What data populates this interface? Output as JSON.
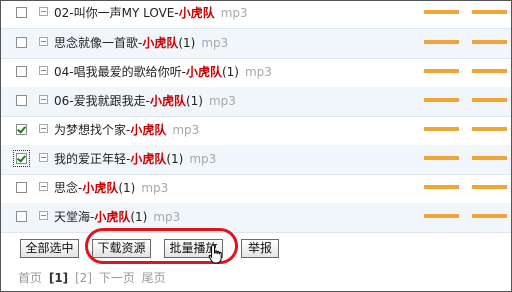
{
  "songs": [
    {
      "checked": false,
      "prefix": "02-叫你一声MY LOVE-",
      "artist": "小虎队",
      "count": "",
      "ext": "mp3"
    },
    {
      "checked": false,
      "prefix": "思念就像一首歌-",
      "artist": "小虎队",
      "count": "(1)",
      "ext": "mp3"
    },
    {
      "checked": false,
      "prefix": "04-唱我最爱的歌给你听-",
      "artist": "小虎队",
      "count": "(1)",
      "ext": "mp3"
    },
    {
      "checked": false,
      "prefix": "06-爱我就跟我走-",
      "artist": "小虎队",
      "count": "(1)",
      "ext": "mp3"
    },
    {
      "checked": true,
      "prefix": "为梦想找个家-",
      "artist": "小虎队",
      "count": "",
      "ext": "mp3"
    },
    {
      "checked": true,
      "prefix": "我的爱正年轻-",
      "artist": "小虎队",
      "count": "(1)",
      "ext": "mp3"
    },
    {
      "checked": false,
      "prefix": "思念-",
      "artist": "小虎队",
      "count": "(1)",
      "ext": "mp3"
    },
    {
      "checked": false,
      "prefix": "天堂海-",
      "artist": "小虎队",
      "count": "(1)",
      "ext": "mp3"
    }
  ],
  "buttons": {
    "select_all": "全部选中",
    "download": "下载资源",
    "batch_play": "批量播放",
    "report": "举报"
  },
  "pager": {
    "first": "首页",
    "page1": "[1]",
    "page2": "[2]",
    "next": "下一页",
    "last": "尾页"
  },
  "colors": {
    "artist": "#cc0000",
    "rating_bar": "#f0a636",
    "highlight_ring": "#e0141b",
    "checkbox_tick": "#1e7d1e"
  }
}
